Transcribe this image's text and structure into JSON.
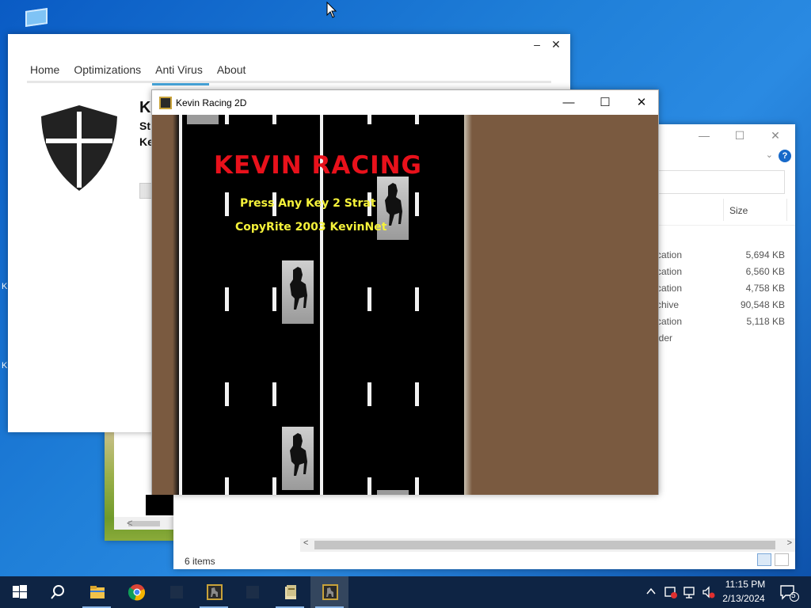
{
  "desktop": {
    "icon_name": "monitor-icon",
    "side_labels": [
      "K",
      "K"
    ]
  },
  "antivirus": {
    "nav": [
      "Home",
      "Optimizations",
      "Anti Virus",
      "About"
    ],
    "active_tab": "Anti Virus",
    "header_partial": "Ke",
    "line1_partial": "St",
    "line2_partial": "Ke",
    "minimize": "–",
    "close": "✕"
  },
  "explorer": {
    "size_header": "Size",
    "rows": [
      {
        "type": "cation",
        "size": "5,694 KB"
      },
      {
        "type": "cation",
        "size": "6,560 KB"
      },
      {
        "type": "cation",
        "size": "4,758 KB"
      },
      {
        "type": "chive",
        "size": "90,548 KB"
      },
      {
        "type": "cation",
        "size": "5,118 KB"
      },
      {
        "type": "lder",
        "size": ""
      }
    ],
    "status": "6 items",
    "help": "?"
  },
  "racing": {
    "window_title": "Kevin Racing 2D",
    "game_title": "KEVIN RACING",
    "line1": "Press Any Key 2 Strat",
    "line2": "CopyRite 2003 KevinNet",
    "minimize": "—",
    "maximize": "☐",
    "close": "✕"
  },
  "taskbar": {
    "items": [
      "start-button",
      "search-button",
      "file-explorer",
      "chrome",
      "app-dim-1",
      "kevin-racing-1",
      "app-dim-2",
      "app-book",
      "kevin-racing-2"
    ],
    "time": "11:15 PM",
    "date": "2/13/2024",
    "notification_count": "5"
  },
  "colors": {
    "road": "#000000",
    "dirt": "#7a5a40",
    "title_red": "#e8111b",
    "text_yellow": "#f5f23a",
    "accent_blue": "#46a4d8",
    "taskbar": "#0e2444"
  }
}
